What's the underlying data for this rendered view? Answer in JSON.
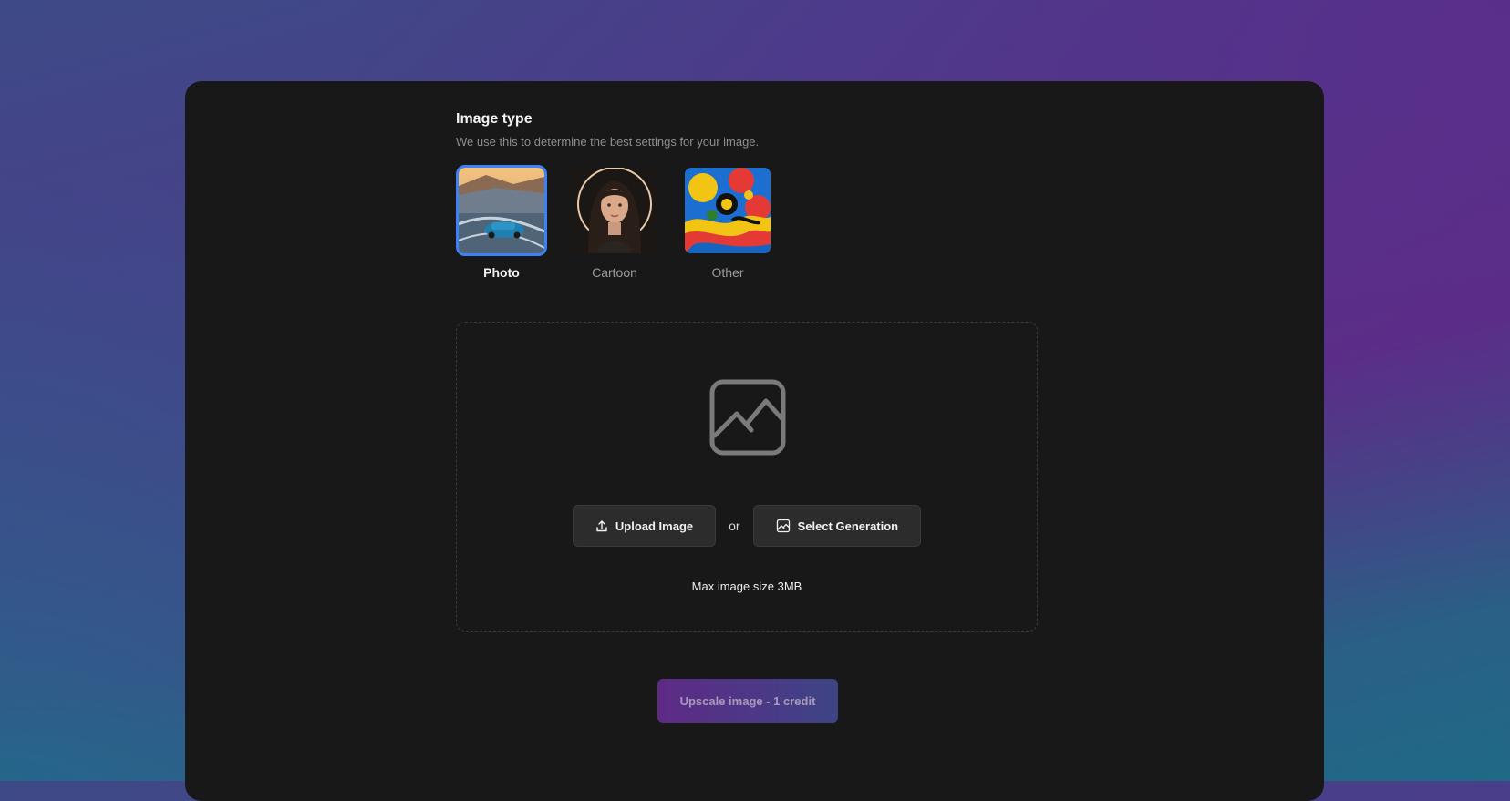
{
  "image_type": {
    "title": "Image type",
    "subtitle": "We use this to determine the best settings for your image.",
    "options": [
      {
        "label": "Photo",
        "selected": true
      },
      {
        "label": "Cartoon",
        "selected": false
      },
      {
        "label": "Other",
        "selected": false
      }
    ]
  },
  "dropzone": {
    "upload_label": "Upload Image",
    "or_label": "or",
    "select_label": "Select Generation",
    "max_size": "Max image size 3MB",
    "icons": [
      "image-placeholder-icon",
      "upload-icon",
      "image-icon"
    ]
  },
  "action": {
    "upscale_label": "Upscale image - 1 credit"
  },
  "colors": {
    "selected_border": "#3b82f6",
    "card_bg": "#181818",
    "button_bg": "#2c2c2c",
    "upscale_gradient_start": "#5e2a86",
    "upscale_gradient_end": "#3d4486"
  }
}
